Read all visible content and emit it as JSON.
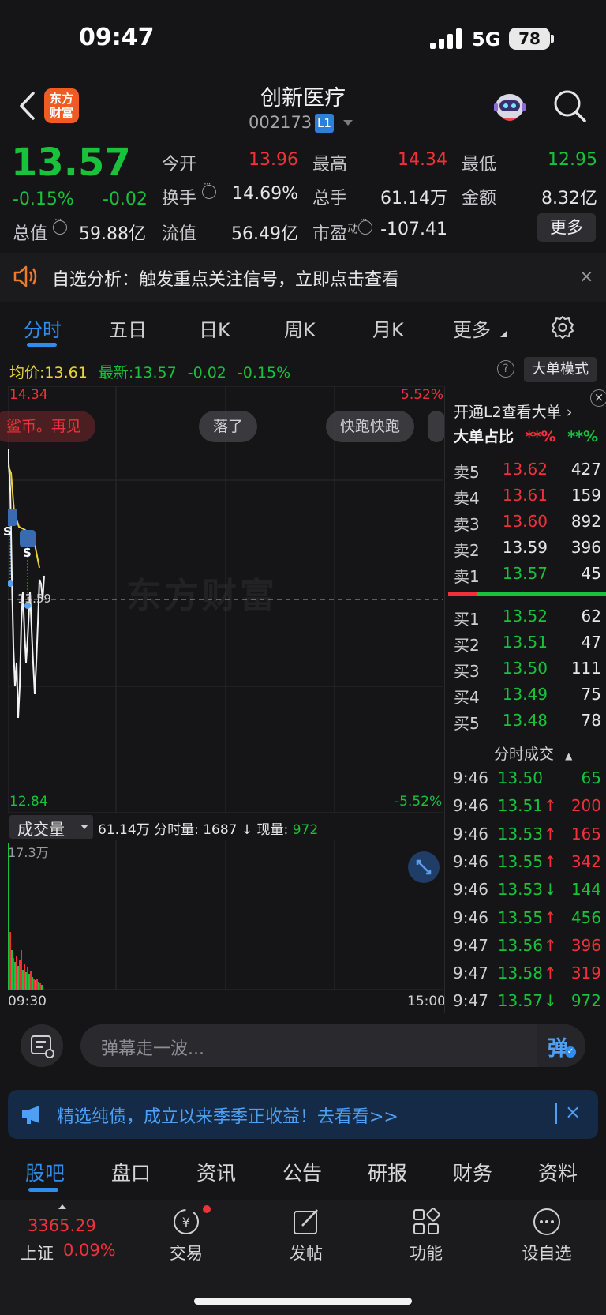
{
  "status_bar": {
    "time": "09:47",
    "network": "5G",
    "battery": "78"
  },
  "header": {
    "title": "创新医疗",
    "code": "002173",
    "level_badge": "L1",
    "logo_text_line1": "东方",
    "logo_text_line2": "财富"
  },
  "quote": {
    "price": "13.57",
    "change_pct": "-0.15%",
    "change_val": "-0.02",
    "open_label": "今开",
    "open": "13.96",
    "high_label": "最高",
    "high": "14.34",
    "low_label": "最低",
    "low": "12.95",
    "turnover_label": "换手",
    "turnover": "14.69%",
    "volume_label": "总手",
    "volume": "61.14万",
    "amount_label": "金额",
    "amount": "8.32亿",
    "mkt_cap_label": "总值",
    "mkt_cap": "59.88亿",
    "float_cap_label": "流值",
    "float_cap": "56.49亿",
    "pe_label": "市盈",
    "pe_sup": "动",
    "pe": "-107.41",
    "more_label": "更多"
  },
  "notice": {
    "text": "自选分析：触发重点关注信号，立即点击查看",
    "close": "×"
  },
  "tabs": [
    {
      "label": "分时"
    },
    {
      "label": "五日"
    },
    {
      "label": "日K"
    },
    {
      "label": "周K"
    },
    {
      "label": "月K"
    },
    {
      "label": "更多"
    }
  ],
  "chart_info": {
    "avg_label": "均价:",
    "avg": "13.61",
    "latest_label": "最新:",
    "latest": "13.57",
    "change": "-0.02",
    "change_pct": "-0.15%",
    "help": "?",
    "big_mode": "大单模式"
  },
  "chart_axes": {
    "y_top": "14.34",
    "y_bottom": "12.84",
    "pct_top": "5.52%",
    "pct_bottom": "-5.52%",
    "ref_price": "13.59",
    "x_start": "09:30",
    "x_end": "15:00",
    "marker_label": "S"
  },
  "danmu": [
    "鲨币。再见",
    "落了",
    "快跑快跑"
  ],
  "watermark": "东方财富",
  "volume_panel": {
    "selector": "成交量",
    "total": "61.14万",
    "period_label": "分时量:",
    "period": "1687",
    "now_label": "现量:",
    "now": "972",
    "y_max": "17.3万"
  },
  "chart_data": {
    "type": "line",
    "title": "",
    "ylim": [
      12.84,
      14.34
    ],
    "xlabel": "",
    "ylabel": "",
    "x_range": [
      "09:30",
      "15:00"
    ],
    "series": [],
    "volume": {
      "type": "bar",
      "ylim": [
        0,
        173000
      ]
    }
  },
  "order_book": {
    "promo": "开通L2查看大单 ›",
    "ratio_label": "大单占比",
    "ratio_buy": "**%",
    "ratio_sell": "**%",
    "asks": [
      {
        "label": "卖5",
        "price": "13.62",
        "vol": "427",
        "color": "#f0313a"
      },
      {
        "label": "卖4",
        "price": "13.61",
        "vol": "159",
        "color": "#f0313a"
      },
      {
        "label": "卖3",
        "price": "13.60",
        "vol": "892",
        "color": "#f0313a"
      },
      {
        "label": "卖2",
        "price": "13.59",
        "vol": "396",
        "color": "#e6e6e8"
      },
      {
        "label": "卖1",
        "price": "13.57",
        "vol": "45",
        "color": "#18c23a"
      }
    ],
    "bids": [
      {
        "label": "买1",
        "price": "13.52",
        "vol": "62"
      },
      {
        "label": "买2",
        "price": "13.51",
        "vol": "47"
      },
      {
        "label": "买3",
        "price": "13.50",
        "vol": "111"
      },
      {
        "label": "买4",
        "price": "13.49",
        "vol": "75"
      },
      {
        "label": "买5",
        "price": "13.48",
        "vol": "78"
      }
    ],
    "trades_title": "分时成交",
    "trades": [
      {
        "time": "9:46",
        "price": "13.50",
        "dir": "",
        "vol": "65",
        "vol_color": "#18c23a"
      },
      {
        "time": "9:46",
        "price": "13.51",
        "dir": "↑",
        "vol": "200",
        "vol_color": "#f0313a"
      },
      {
        "time": "9:46",
        "price": "13.53",
        "dir": "↑",
        "vol": "165",
        "vol_color": "#f0313a"
      },
      {
        "time": "9:46",
        "price": "13.55",
        "dir": "↑",
        "vol": "342",
        "vol_color": "#f0313a"
      },
      {
        "time": "9:46",
        "price": "13.53",
        "dir": "↓",
        "vol": "144",
        "vol_color": "#18c23a"
      },
      {
        "time": "9:46",
        "price": "13.55",
        "dir": "↑",
        "vol": "456",
        "vol_color": "#18c23a"
      },
      {
        "time": "9:47",
        "price": "13.56",
        "dir": "↑",
        "vol": "396",
        "vol_color": "#f0313a"
      },
      {
        "time": "9:47",
        "price": "13.58",
        "dir": "↑",
        "vol": "319",
        "vol_color": "#f0313a"
      },
      {
        "time": "9:47",
        "price": "13.57",
        "dir": "↓",
        "vol": "972",
        "vol_color": "#18c23a"
      }
    ]
  },
  "danmu_input": {
    "placeholder": "弹幕走一波...",
    "send": "弹"
  },
  "ad": {
    "text": "精选纯债，成立以来季季正收益！去看看>>",
    "close": "×"
  },
  "bottom_tabs": [
    {
      "label": "股吧"
    },
    {
      "label": "盘口"
    },
    {
      "label": "资讯"
    },
    {
      "label": "公告"
    },
    {
      "label": "研报"
    },
    {
      "label": "财务"
    },
    {
      "label": "资料"
    }
  ],
  "dock": {
    "index_value": "3365.29",
    "index_name": "上证",
    "index_pct": "0.09%",
    "items": [
      {
        "label": "交易",
        "icon": "trade-icon"
      },
      {
        "label": "发帖",
        "icon": "post-icon"
      },
      {
        "label": "功能",
        "icon": "apps-icon"
      },
      {
        "label": "设自选",
        "icon": "add-watchlist-icon"
      }
    ]
  }
}
